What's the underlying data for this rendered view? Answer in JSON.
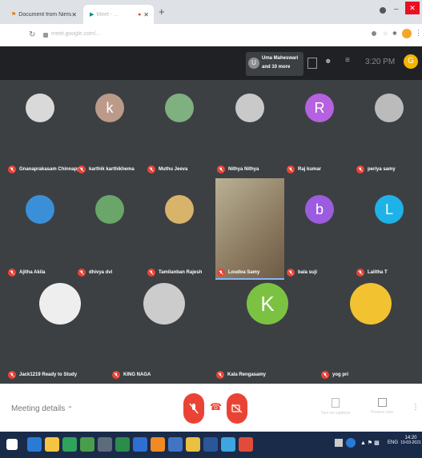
{
  "browser": {
    "tabs": [
      {
        "label": "Document from Nirmala - pages",
        "active": false
      },
      {
        "label": "Meet - ...",
        "active": true
      }
    ],
    "new_tab": "+",
    "url": "meet.google.com/..."
  },
  "meet_header": {
    "participants_summary_line1": "Uma Maheswari",
    "participants_summary_line2": "and 10 more",
    "avatar_initial": "U",
    "clock": "3:20 PM",
    "user_initial": "G"
  },
  "participants": [
    {
      "name": "Gnanaprakasam Chinnapp...",
      "initial": "",
      "color": "#d9d9d9"
    },
    {
      "name": "karthik karthikhema",
      "initial": "k",
      "color": "#bc9a8a"
    },
    {
      "name": "Muthu Jeeva",
      "initial": "",
      "color": "#7fb07f"
    },
    {
      "name": "Nithya Nithya",
      "initial": "",
      "color": "#c9c9c9"
    },
    {
      "name": "Raj kumar",
      "initial": "R",
      "color": "#b561e0"
    },
    {
      "name": "periya samy",
      "initial": "",
      "color": "#bbbbbb"
    },
    {
      "name": "Ajitha Akila",
      "initial": "",
      "color": "#3b8fd8"
    },
    {
      "name": "dhivya dvi",
      "initial": "",
      "color": "#6aa56a"
    },
    {
      "name": "Tamilanban Rajesh",
      "initial": "",
      "color": "#d8b46a"
    },
    {
      "name": "Loudoa Samy",
      "initial": "",
      "color": "#a89072"
    },
    {
      "name": "bala suji",
      "initial": "b",
      "color": "#9c5ce0"
    },
    {
      "name": "Lalitha T",
      "initial": "L",
      "color": "#1fb2e8"
    },
    {
      "name": "Jack1219 Ready to Study",
      "initial": "",
      "color": "#eeeeee"
    },
    {
      "name": "KING NAGA",
      "initial": "",
      "color": "#cccccc"
    },
    {
      "name": "Kala Rengasamy",
      "initial": "K",
      "color": "#7cc242"
    },
    {
      "name": "yog pri",
      "initial": "",
      "color": "#f2c230"
    }
  ],
  "bottom_bar": {
    "meeting_details": "Meeting details",
    "captions_label": "Turn on captions",
    "present_label": "Present now"
  },
  "taskbar": {
    "lang": "ENG",
    "time": "14:20",
    "date": "19-03-2021"
  }
}
